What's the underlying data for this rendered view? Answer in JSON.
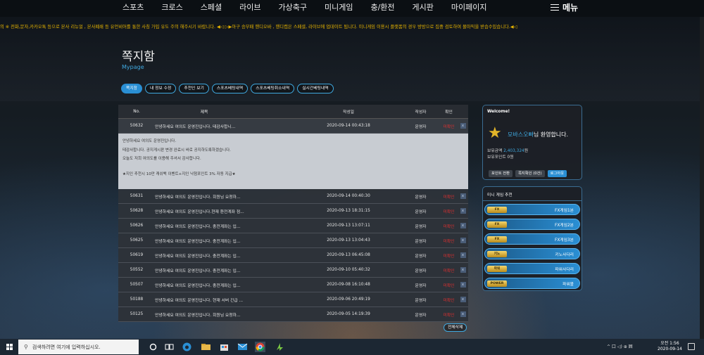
{
  "nav": {
    "items": [
      "스포츠",
      "크로스",
      "스페셜",
      "라이브",
      "가상축구",
      "미니게임",
      "충/환전",
      "게시판",
      "마이페이지"
    ],
    "menu_label": "메뉴"
  },
  "marquee": "의 ※ 전화,문자,카카오톡 등으로 본사 리뉴얼 , 본사폐쇄 등 유언비어를 통한 사칭 가입 유도 주의 해주시기 바랍니다. ◀◁ ▷▶아구 승무패 핸디오바 , 핸디캡은 스페셜, 라이브에 업데이트 됩니다. 미니게임 이용시 플랫폼의 경우 방방으로 집중 검토하여 몰마익을 받습수있습니다.◀◁",
  "page": {
    "title": "쪽지함",
    "subtitle": "Mypage"
  },
  "tabs": [
    "쪽지함",
    "내 정보 수정",
    "추천인 보기",
    "스포츠베팅내역",
    "스포츠베팅취소내역",
    "실시간베팅내역"
  ],
  "table": {
    "headers": {
      "no": "No.",
      "title": "제목",
      "date": "작성일",
      "author": "작성자",
      "check": "확인"
    },
    "rows": [
      {
        "no": "50632",
        "title": "안녕하세요 여의도 운영진입니다. 테감사합니...",
        "date": "2020-09-14 00:43:18",
        "author": "운영자",
        "check": "미확인"
      },
      {
        "no": "50631",
        "title": "안녕하세요 여의도 운영진입니다. 회원님 요청하...",
        "date": "2020-09-14 00:40:30",
        "author": "운영자",
        "check": "미확인"
      },
      {
        "no": "50628",
        "title": "안녕하세요 여의도 운영진입니다.현재 환전계좌 점...",
        "date": "2020-09-13 18:31:15",
        "author": "운영자",
        "check": "미확인"
      },
      {
        "no": "50626",
        "title": "안녕하세요 여의도 운영진입니다. 충전계좌는 입...",
        "date": "2020-09-13 13:07:11",
        "author": "운영자",
        "check": "미확인"
      },
      {
        "no": "50625",
        "title": "안녕하세요 여의도 운영진입니다. 충전계좌는 입...",
        "date": "2020-09-13 13:04:43",
        "author": "운영자",
        "check": "미확인"
      },
      {
        "no": "50619",
        "title": "안녕하세요 여의도 운영진입니다. 충전계좌는 입...",
        "date": "2020-09-13 06:45:08",
        "author": "운영자",
        "check": "미확인"
      },
      {
        "no": "50552",
        "title": "안녕하세요 여의도 운영진입니다. 충전계좌는 입...",
        "date": "2020-09-10 05:40:32",
        "author": "운영자",
        "check": "미확인"
      },
      {
        "no": "50507",
        "title": "안녕하세요 여의도 운영진입니다. 충전계좌는 입...",
        "date": "2020-09-08 16:10:48",
        "author": "운영자",
        "check": "미확인"
      },
      {
        "no": "50188",
        "title": "안녕하세요 여의도 운영진입니다. 현재 서버 긴급 ...",
        "date": "2020-09-06 20:49:19",
        "author": "운영자",
        "check": "미확인"
      },
      {
        "no": "50125",
        "title": "안녕하세요 여의도 운영진입니다. 회원님 요청하...",
        "date": "2020-09-05 14:19:39",
        "author": "운영자",
        "check": "미확인"
      }
    ],
    "check_box_label": "x",
    "detail_lines": [
      "안녕하세요 여의도 운영진입니다.",
      "테감사합니다. 공지게시판 변경 완료시 바로 공지하도록하겠습니다.",
      "오늘도 저희 여의도를 이용해 주셔서 감사합니다.",
      "★지인 추천시 10만 캐쉬백 이벤트+지인 낙첨포인트 3% 자동 지급★"
    ],
    "delete_all_label": "전체삭제"
  },
  "welcome": {
    "title": "Welcome!",
    "nickname": "모바스오빠",
    "greeting_suffix": "님 환영합니다.",
    "level": "1",
    "money_label": "보유금액",
    "money_value": "2,403,324",
    "money_unit": "원",
    "point_label": "보유포인트",
    "point_value": "0",
    "point_unit": "원",
    "buttons": [
      "포인트 전환",
      "쪽지확인 (0건)",
      "로그아웃"
    ]
  },
  "mini_games": {
    "title": "미니 게임 추천",
    "items": [
      {
        "logo": "FX",
        "name": "FX게임1분"
      },
      {
        "logo": "FX",
        "name": "FX게임2분"
      },
      {
        "logo": "FX",
        "name": "FX게임3분"
      },
      {
        "logo": "키노",
        "name": "키노사다리"
      },
      {
        "logo": "파워",
        "name": "파워사다리"
      },
      {
        "logo": "POWER",
        "name": "파워볼"
      }
    ]
  },
  "taskbar": {
    "search_placeholder": "검색하려면 여기에 입력하십시오.",
    "tray_text": "^ 口 ◁) ⊕ 囲",
    "time": "오전 1:56",
    "date": "2020-09-14"
  },
  "colors": {
    "accent": "#3fa9e0",
    "unread": "#e03030",
    "marquee": "#e6b400"
  }
}
